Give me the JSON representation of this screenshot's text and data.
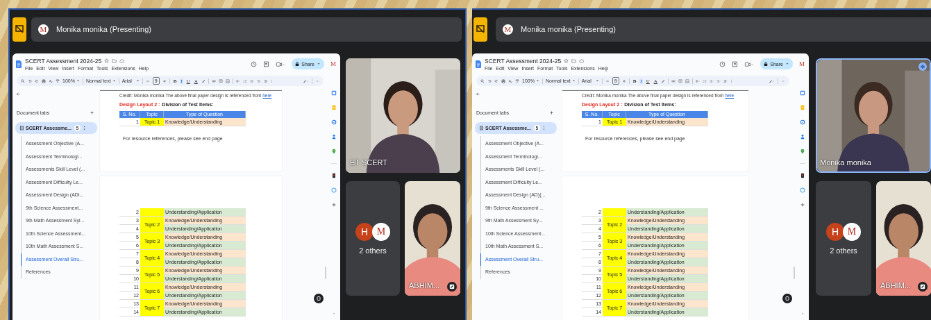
{
  "panels": [
    {
      "presenter": {
        "avatar": "M",
        "label": "Monika monika (Presenting)"
      },
      "doc": {
        "title": "SCERT Assessment 2024-25",
        "menu": [
          "File",
          "Edit",
          "View",
          "Insert",
          "Format",
          "Tools",
          "Extensions",
          "Help"
        ],
        "share": "Share",
        "avatar": "M",
        "toolbar": {
          "zoom": "100%",
          "style": "Normal text",
          "font": "Arial",
          "size": "9"
        },
        "format_buttons": [
          {
            "label": "B",
            "selected": false
          },
          {
            "label": "I",
            "selected": true
          },
          {
            "label": "U",
            "selected": false
          },
          {
            "label": "A",
            "selected": false
          }
        ],
        "tabs_heading": "Document tabs",
        "main_tab": {
          "label": "SCERT Assessme...",
          "count": "5"
        },
        "tabs": [
          {
            "label": "Assessment Objective (A...",
            "selected": false
          },
          {
            "label": "Assessment Terminologi...",
            "selected": false
          },
          {
            "label": "Assessments Skill Level (...",
            "selected": false
          },
          {
            "label": "Assessment Difficulty Le...",
            "selected": false
          },
          {
            "label": "Assessment Design (ADI...",
            "selected": false
          },
          {
            "label": "9th Science Assessment...",
            "selected": false
          },
          {
            "label": "9th Math Assessment Syl...",
            "selected": false
          },
          {
            "label": "10th Science Assessment...",
            "selected": false
          },
          {
            "label": "10th Math Assessment S...",
            "selected": false
          },
          {
            "label": "Assessment Overall Stru...",
            "selected": true
          },
          {
            "label": "References",
            "selected": false
          }
        ],
        "credit": {
          "text": "Credit: Monika monika  The above final paper design is referenced from",
          "link": "here"
        },
        "heading": {
          "label": "Design Layout 2 :",
          "text": "Division of Test Items:"
        },
        "columns": [
          "S. No.",
          "Topic",
          "Type of Question"
        ],
        "page1_groups": [
          {
            "topic": "Topic 1",
            "rows": [
              {
                "sno": "1",
                "question": "Knowledge/Understanding",
                "kind": "knowledge"
              }
            ]
          }
        ],
        "note": "For resource references, please see end page",
        "page2_groups": [
          {
            "rows": [
              {
                "sno": "2",
                "question": "Understanding/Application",
                "kind": "application"
              }
            ]
          },
          {
            "topic": "Topic 2",
            "rows": [
              {
                "sno": "3",
                "question": "Knowledge/Understanding",
                "kind": "knowledge"
              },
              {
                "sno": "4",
                "question": "Understanding/Application",
                "kind": "application"
              }
            ]
          },
          {
            "topic": "Topic 3",
            "rows": [
              {
                "sno": "5",
                "question": "Knowledge/Understanding",
                "kind": "knowledge"
              },
              {
                "sno": "6",
                "question": "Understanding/Application",
                "kind": "application"
              }
            ]
          },
          {
            "topic": "Topic 4",
            "rows": [
              {
                "sno": "7",
                "question": "Knowledge/Understanding",
                "kind": "knowledge"
              },
              {
                "sno": "8",
                "question": "Understanding/Application",
                "kind": "application"
              }
            ]
          },
          {
            "topic": "Topic 5",
            "rows": [
              {
                "sno": "9",
                "question": "Knowledge/Understanding",
                "kind": "knowledge"
              },
              {
                "sno": "10",
                "question": "Understanding/Application",
                "kind": "application"
              }
            ]
          },
          {
            "topic": "Topic 6",
            "rows": [
              {
                "sno": "11",
                "question": "Knowledge/Understanding",
                "kind": "knowledge"
              },
              {
                "sno": "12",
                "question": "Understanding/Application",
                "kind": "application"
              }
            ]
          },
          {
            "topic": "Topic 7",
            "rows": [
              {
                "sno": "13",
                "question": "Knowledge/Understanding",
                "kind": "knowledge"
              },
              {
                "sno": "14",
                "question": "Understanding/Application",
                "kind": "application"
              }
            ]
          }
        ]
      },
      "tiles": [
        {
          "kind": "video",
          "name": "ET SCERT",
          "speaking": false,
          "pinned": false
        },
        {
          "kind": "others",
          "label": "2 others",
          "avatars": [
            {
              "letter": "H",
              "color": "#c5421b"
            },
            {
              "letter": "M",
              "color": "#ffffff"
            }
          ]
        },
        {
          "kind": "video",
          "name": "ABHIM...",
          "speaking": false,
          "pinned": true
        }
      ]
    },
    {
      "presenter": {
        "avatar": "M",
        "label": "Monika monika (Presenting)"
      },
      "doc": {
        "title": "SCERT Assessment 2024-25",
        "menu": [
          "File",
          "Edit",
          "View",
          "Insert",
          "Format",
          "Tools",
          "Extensions",
          "Help"
        ],
        "share": "Share",
        "avatar": "M",
        "toolbar": {
          "zoom": "100%",
          "style": "Normal text",
          "font": "Arial",
          "size": "9"
        },
        "format_buttons": [
          {
            "label": "B",
            "selected": false
          },
          {
            "label": "I",
            "selected": true
          },
          {
            "label": "U",
            "selected": false
          },
          {
            "label": "A",
            "selected": false
          }
        ],
        "tabs_heading": "Document tabs",
        "main_tab": {
          "label": "SCERT Assessme...",
          "count": "5"
        },
        "tabs": [
          {
            "label": "Assessment Objective (A...",
            "selected": false
          },
          {
            "label": "Assessment Terminologi...",
            "selected": false
          },
          {
            "label": "Assessments Skill Level (...",
            "selected": false
          },
          {
            "label": "Assessment Difficulty Le...",
            "selected": false
          },
          {
            "label": "Assessment Design (AD)(...",
            "selected": false
          },
          {
            "label": "9th Science Assessment ...",
            "selected": false
          },
          {
            "label": "9th Math Assessment Sy...",
            "selected": false
          },
          {
            "label": "10th Science Assessment...",
            "selected": false
          },
          {
            "label": "10th Math Assessment S...",
            "selected": false
          },
          {
            "label": "Assessment Overall Stru...",
            "selected": true
          },
          {
            "label": "References",
            "selected": false
          }
        ],
        "credit": {
          "text": "Credit: Monika monika  The above final paper design is referenced from",
          "link": "here"
        },
        "heading": {
          "label": "Design Layout 2 :",
          "text": "Division of Test Items:"
        },
        "columns": [
          "S. No.",
          "Topic",
          "Type of Question"
        ],
        "page1_groups": [
          {
            "topic": "Topic 1",
            "rows": [
              {
                "sno": "1",
                "question": "Knowledge/Understanding",
                "kind": "knowledge"
              }
            ]
          }
        ],
        "note": "For resource references, please see end page",
        "page2_groups": [
          {
            "rows": [
              {
                "sno": "2",
                "question": "Understanding/Application",
                "kind": "application"
              }
            ]
          },
          {
            "topic": "Topic 2",
            "rows": [
              {
                "sno": "3",
                "question": "Knowledge/Understanding",
                "kind": "knowledge"
              },
              {
                "sno": "4",
                "question": "Understanding/Application",
                "kind": "application"
              }
            ]
          },
          {
            "topic": "Topic 3",
            "rows": [
              {
                "sno": "5",
                "question": "Knowledge/Understanding",
                "kind": "knowledge"
              },
              {
                "sno": "6",
                "question": "Understanding/Application",
                "kind": "application"
              }
            ]
          },
          {
            "topic": "Topic 4",
            "rows": [
              {
                "sno": "7",
                "question": "Knowledge/Understanding",
                "kind": "knowledge"
              },
              {
                "sno": "8",
                "question": "Understanding/Application",
                "kind": "application"
              }
            ]
          },
          {
            "topic": "Topic 5",
            "rows": [
              {
                "sno": "9",
                "question": "Knowledge/Understanding",
                "kind": "knowledge"
              },
              {
                "sno": "10",
                "question": "Understanding/Application",
                "kind": "application"
              }
            ]
          },
          {
            "topic": "Topic 6",
            "rows": [
              {
                "sno": "11",
                "question": "Knowledge/Understanding",
                "kind": "knowledge"
              },
              {
                "sno": "12",
                "question": "Understanding/Application",
                "kind": "application"
              }
            ]
          },
          {
            "topic": "Topic 7",
            "rows": [
              {
                "sno": "13",
                "question": "Knowledge/Understanding",
                "kind": "knowledge"
              },
              {
                "sno": "14",
                "question": "Understanding/Application",
                "kind": "application"
              }
            ]
          }
        ]
      },
      "tiles": [
        {
          "kind": "video",
          "name": "Monika monika",
          "speaking": true,
          "pinned": false
        },
        {
          "kind": "others",
          "label": "2 others",
          "avatars": [
            {
              "letter": "H",
              "color": "#c5421b"
            },
            {
              "letter": "M",
              "color": "#ffffff"
            }
          ]
        },
        {
          "kind": "video",
          "name": "ABHIM...",
          "speaking": false,
          "pinned": true
        }
      ]
    }
  ]
}
